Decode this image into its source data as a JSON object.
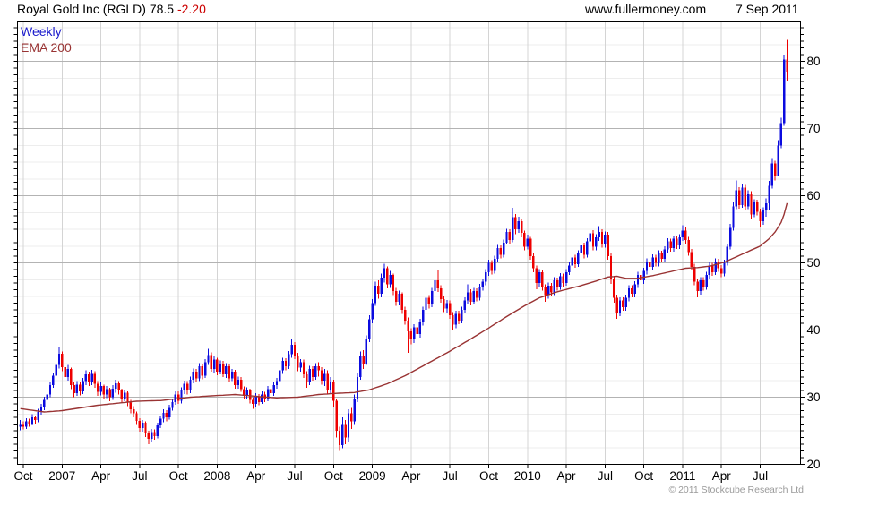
{
  "header": {
    "title": "Royal Gold Inc (RGLD) 78.5",
    "change": "-2.20",
    "site": "www.fullermoney.com",
    "date": "7 Sep 2011"
  },
  "legend": {
    "timeframe": "Weekly",
    "indicator": "EMA 200"
  },
  "footer": {
    "copyright": "© 2011 Stockcube Research Ltd"
  },
  "colors": {
    "up_candle": "#0b0bdf",
    "down_candle": "#ee0000",
    "ema_line": "#993333",
    "weekly_label": "#1a1acc",
    "ema_label": "#993333",
    "change_text": "#cc0000",
    "copyright_text": "#9a9a9a",
    "grid_minor": "#ededed",
    "grid_major": "#b3b3b3",
    "grid_vertical": "#d4d4d4",
    "axis": "#000000"
  },
  "chart_data": {
    "type": "candlestick",
    "timeframe": "Weekly",
    "indicator": "EMA 200",
    "title": "Royal Gold Inc (RGLD)",
    "last_price": 78.5,
    "change": -2.2,
    "y_axis": {
      "min": 20,
      "max": 85.9,
      "major_tick_labels": [
        20,
        30,
        40,
        50,
        60,
        70,
        80
      ],
      "minor_tick_step": 1,
      "grid_minor_step": 2.5,
      "grid_major_step": 10,
      "side": "right"
    },
    "x_axis": {
      "tick_labels": [
        "Oct",
        "2007",
        "Apr",
        "Jul",
        "Oct",
        "2008",
        "Apr",
        "Jul",
        "Oct",
        "2009",
        "Apr",
        "Jul",
        "Oct",
        "2010",
        "Apr",
        "Jul",
        "Oct",
        "2011",
        "Apr",
        "Jul"
      ],
      "tick_week_indexes": [
        1,
        14,
        27,
        40,
        53,
        66,
        79,
        92,
        105,
        118,
        131,
        144,
        157,
        170,
        183,
        196,
        209,
        222,
        235,
        248
      ],
      "start": "Oct 2006",
      "end": "7 Sep 2011"
    },
    "first_open": 25.6,
    "candles_hlc": [
      [
        26.6,
        25.1,
        26.0
      ],
      [
        26.4,
        25.2,
        25.6
      ],
      [
        26.9,
        25.3,
        26.4
      ],
      [
        26.8,
        25.6,
        26.1
      ],
      [
        27.5,
        25.8,
        27.0
      ],
      [
        27.3,
        26.1,
        26.6
      ],
      [
        28.3,
        26.3,
        27.8
      ],
      [
        29.0,
        27.4,
        28.5
      ],
      [
        30.1,
        28.1,
        29.6
      ],
      [
        30.9,
        29.2,
        30.4
      ],
      [
        32.3,
        30.0,
        31.8
      ],
      [
        33.7,
        31.4,
        33.2
      ],
      [
        35.3,
        32.6,
        34.8
      ],
      [
        37.4,
        34.3,
        36.5
      ],
      [
        36.8,
        33.9,
        34.5
      ],
      [
        34.9,
        32.3,
        33.0
      ],
      [
        34.8,
        32.5,
        34.2
      ],
      [
        34.4,
        31.2,
        31.8
      ],
      [
        32.2,
        30.0,
        30.6
      ],
      [
        32.4,
        30.2,
        31.9
      ],
      [
        32.2,
        30.3,
        30.9
      ],
      [
        32.9,
        30.5,
        32.4
      ],
      [
        34.0,
        31.8,
        33.4
      ],
      [
        33.8,
        31.7,
        32.2
      ],
      [
        34.1,
        31.8,
        33.5
      ],
      [
        33.9,
        31.4,
        32.0
      ],
      [
        32.4,
        30.2,
        30.8
      ],
      [
        32.2,
        30.3,
        31.7
      ],
      [
        31.9,
        29.8,
        30.4
      ],
      [
        31.7,
        29.9,
        31.2
      ],
      [
        31.4,
        29.4,
        30.0
      ],
      [
        31.8,
        29.6,
        31.3
      ],
      [
        32.6,
        30.7,
        32.1
      ],
      [
        32.4,
        30.4,
        31.0
      ],
      [
        31.3,
        29.3,
        29.8
      ],
      [
        31.1,
        29.4,
        30.7
      ],
      [
        30.9,
        28.7,
        29.2
      ],
      [
        29.6,
        27.6,
        28.2
      ],
      [
        28.7,
        27.0,
        27.6
      ],
      [
        27.9,
        26.0,
        26.5
      ],
      [
        26.9,
        24.9,
        25.4
      ],
      [
        26.6,
        24.9,
        26.2
      ],
      [
        26.4,
        24.1,
        24.6
      ],
      [
        25.0,
        23.0,
        23.8
      ],
      [
        25.3,
        23.3,
        24.8
      ],
      [
        25.2,
        23.7,
        24.2
      ],
      [
        26.2,
        23.9,
        25.8
      ],
      [
        27.3,
        25.4,
        26.8
      ],
      [
        28.2,
        26.3,
        27.7
      ],
      [
        28.1,
        26.4,
        27.0
      ],
      [
        28.9,
        26.7,
        28.4
      ],
      [
        29.8,
        28.0,
        29.3
      ],
      [
        30.9,
        28.9,
        30.4
      ],
      [
        30.9,
        29.0,
        29.5
      ],
      [
        31.5,
        29.1,
        31.0
      ],
      [
        32.5,
        30.5,
        32.0
      ],
      [
        32.4,
        30.4,
        31.0
      ],
      [
        33.1,
        30.6,
        32.6
      ],
      [
        34.3,
        32.1,
        33.8
      ],
      [
        34.2,
        32.2,
        32.8
      ],
      [
        35.1,
        32.4,
        34.6
      ],
      [
        35.0,
        32.7,
        33.2
      ],
      [
        35.7,
        32.9,
        35.2
      ],
      [
        37.2,
        34.8,
        36.3
      ],
      [
        36.7,
        33.8,
        34.2
      ],
      [
        36.1,
        33.7,
        35.6
      ],
      [
        35.9,
        33.3,
        33.8
      ],
      [
        35.5,
        33.4,
        35.0
      ],
      [
        35.4,
        33.0,
        33.4
      ],
      [
        35.1,
        32.9,
        34.6
      ],
      [
        34.9,
        32.3,
        32.8
      ],
      [
        34.2,
        32.4,
        33.8
      ],
      [
        34.1,
        31.3,
        31.8
      ],
      [
        33.1,
        31.3,
        32.6
      ],
      [
        33.0,
        30.8,
        31.2
      ],
      [
        31.6,
        29.7,
        30.2
      ],
      [
        31.5,
        29.7,
        31.0
      ],
      [
        31.3,
        29.1,
        29.6
      ],
      [
        30.0,
        28.3,
        29.0
      ],
      [
        30.6,
        28.6,
        30.1
      ],
      [
        30.5,
        28.8,
        29.3
      ],
      [
        30.9,
        29.0,
        30.4
      ],
      [
        30.8,
        29.3,
        29.8
      ],
      [
        31.7,
        29.4,
        31.2
      ],
      [
        31.6,
        30.1,
        30.6
      ],
      [
        32.3,
        30.2,
        31.8
      ],
      [
        32.9,
        31.3,
        32.4
      ],
      [
        34.5,
        32.0,
        34.0
      ],
      [
        35.9,
        33.5,
        35.4
      ],
      [
        35.8,
        34.0,
        34.6
      ],
      [
        36.9,
        34.2,
        36.4
      ],
      [
        38.6,
        35.9,
        37.8
      ],
      [
        38.2,
        35.7,
        36.2
      ],
      [
        36.6,
        33.9,
        34.4
      ],
      [
        35.7,
        33.8,
        35.2
      ],
      [
        35.6,
        32.9,
        33.4
      ],
      [
        33.9,
        31.4,
        32.2
      ],
      [
        34.7,
        31.8,
        34.2
      ],
      [
        34.6,
        32.5,
        33.0
      ],
      [
        35.1,
        32.6,
        34.6
      ],
      [
        35.2,
        33.1,
        34.0
      ],
      [
        34.5,
        31.9,
        32.5
      ],
      [
        34.2,
        31.7,
        33.5
      ],
      [
        34.0,
        30.4,
        31.0
      ],
      [
        33.0,
        30.5,
        32.3
      ],
      [
        32.6,
        28.6,
        29.5
      ],
      [
        29.8,
        24.0,
        25.0
      ],
      [
        25.6,
        22.0,
        22.9
      ],
      [
        27.0,
        22.4,
        26.0
      ],
      [
        26.6,
        23.0,
        24.0
      ],
      [
        28.2,
        23.4,
        27.6
      ],
      [
        28.4,
        25.3,
        26.4
      ],
      [
        30.4,
        26.0,
        29.8
      ],
      [
        33.6,
        29.3,
        33.0
      ],
      [
        36.8,
        32.6,
        36.2
      ],
      [
        37.0,
        34.2,
        35.0
      ],
      [
        39.2,
        34.8,
        38.6
      ],
      [
        42.2,
        38.2,
        41.6
      ],
      [
        44.6,
        41.0,
        44.0
      ],
      [
        47.2,
        43.6,
        46.6
      ],
      [
        47.4,
        44.7,
        45.4
      ],
      [
        48.4,
        44.9,
        47.8
      ],
      [
        49.9,
        47.1,
        49.2
      ],
      [
        49.5,
        46.2,
        46.8
      ],
      [
        48.8,
        46.3,
        48.2
      ],
      [
        48.4,
        45.2,
        45.8
      ],
      [
        46.3,
        43.6,
        44.2
      ],
      [
        45.9,
        43.7,
        45.4
      ],
      [
        45.6,
        42.4,
        43.0
      ],
      [
        43.5,
        40.8,
        41.4
      ],
      [
        41.9,
        36.6,
        39.8
      ],
      [
        40.3,
        37.9,
        38.6
      ],
      [
        40.9,
        38.1,
        40.4
      ],
      [
        40.8,
        38.8,
        39.4
      ],
      [
        41.7,
        38.9,
        41.2
      ],
      [
        43.5,
        40.7,
        43.0
      ],
      [
        45.3,
        42.5,
        44.8
      ],
      [
        45.2,
        43.2,
        43.8
      ],
      [
        46.3,
        43.4,
        45.8
      ],
      [
        48.3,
        45.3,
        47.4
      ],
      [
        48.9,
        45.7,
        46.2
      ],
      [
        46.7,
        44.1,
        44.6
      ],
      [
        45.1,
        42.7,
        43.2
      ],
      [
        44.5,
        42.6,
        44.0
      ],
      [
        44.4,
        41.7,
        42.2
      ],
      [
        42.7,
        40.1,
        40.8
      ],
      [
        42.9,
        40.3,
        42.4
      ],
      [
        42.9,
        40.9,
        41.4
      ],
      [
        43.5,
        41.0,
        43.0
      ],
      [
        44.9,
        42.5,
        44.4
      ],
      [
        46.8,
        43.9,
        45.6
      ],
      [
        46.1,
        43.7,
        44.2
      ],
      [
        46.3,
        43.8,
        45.8
      ],
      [
        46.2,
        44.3,
        44.8
      ],
      [
        46.9,
        44.4,
        46.4
      ],
      [
        47.7,
        45.9,
        47.2
      ],
      [
        49.1,
        46.7,
        48.6
      ],
      [
        50.5,
        48.1,
        50.0
      ],
      [
        50.4,
        48.3,
        48.8
      ],
      [
        51.1,
        48.4,
        50.6
      ],
      [
        52.7,
        50.1,
        52.2
      ],
      [
        52.6,
        50.7,
        51.2
      ],
      [
        53.5,
        50.8,
        53.0
      ],
      [
        55.1,
        52.9,
        54.6
      ],
      [
        55.0,
        52.9,
        53.4
      ],
      [
        58.2,
        53.1,
        56.8
      ],
      [
        57.3,
        54.3,
        55.0
      ],
      [
        56.9,
        54.5,
        56.2
      ],
      [
        56.6,
        53.8,
        54.5
      ],
      [
        54.8,
        51.9,
        52.4
      ],
      [
        54.2,
        52.0,
        53.6
      ],
      [
        53.9,
        50.5,
        51.0
      ],
      [
        51.5,
        48.6,
        49.2
      ],
      [
        49.6,
        46.1,
        47.0
      ],
      [
        49.1,
        46.5,
        48.6
      ],
      [
        48.9,
        45.9,
        46.4
      ],
      [
        46.8,
        44.2,
        45.2
      ],
      [
        47.1,
        44.7,
        46.6
      ],
      [
        47.0,
        45.1,
        45.6
      ],
      [
        47.9,
        45.2,
        47.4
      ],
      [
        47.8,
        45.9,
        46.4
      ],
      [
        48.5,
        46.0,
        48.0
      ],
      [
        48.4,
        46.5,
        47.0
      ],
      [
        49.1,
        46.6,
        48.6
      ],
      [
        50.1,
        48.2,
        49.6
      ],
      [
        51.3,
        49.0,
        50.8
      ],
      [
        51.2,
        49.3,
        49.8
      ],
      [
        51.9,
        49.4,
        51.4
      ],
      [
        53.1,
        50.9,
        52.6
      ],
      [
        53.0,
        50.7,
        51.2
      ],
      [
        53.7,
        50.8,
        53.2
      ],
      [
        55.1,
        52.7,
        54.4
      ],
      [
        54.9,
        51.9,
        52.4
      ],
      [
        54.3,
        51.9,
        53.8
      ],
      [
        55.5,
        53.3,
        54.6
      ],
      [
        55.0,
        52.3,
        52.8
      ],
      [
        54.7,
        52.3,
        54.2
      ],
      [
        54.6,
        50.5,
        51.0
      ],
      [
        51.5,
        46.9,
        47.6
      ],
      [
        48.1,
        44.1,
        44.8
      ],
      [
        45.3,
        41.7,
        42.6
      ],
      [
        44.9,
        42.1,
        44.4
      ],
      [
        44.9,
        42.9,
        43.4
      ],
      [
        45.3,
        42.9,
        44.8
      ],
      [
        46.7,
        44.3,
        46.2
      ],
      [
        46.7,
        44.9,
        45.4
      ],
      [
        47.3,
        44.9,
        46.8
      ],
      [
        48.7,
        46.3,
        48.2
      ],
      [
        48.6,
        46.9,
        47.4
      ],
      [
        49.3,
        46.9,
        48.8
      ],
      [
        50.7,
        48.3,
        50.2
      ],
      [
        50.6,
        48.9,
        49.4
      ],
      [
        51.3,
        48.9,
        50.8
      ],
      [
        51.2,
        49.5,
        50.0
      ],
      [
        51.9,
        49.5,
        51.4
      ],
      [
        51.8,
        50.1,
        50.6
      ],
      [
        52.5,
        50.1,
        52.0
      ],
      [
        53.7,
        51.5,
        53.2
      ],
      [
        53.6,
        51.7,
        52.2
      ],
      [
        54.1,
        51.7,
        53.6
      ],
      [
        54.0,
        52.1,
        52.6
      ],
      [
        54.3,
        52.1,
        53.8
      ],
      [
        55.6,
        53.3,
        54.8
      ],
      [
        55.3,
        52.9,
        53.4
      ],
      [
        53.9,
        51.1,
        51.6
      ],
      [
        52.1,
        48.9,
        49.4
      ],
      [
        49.9,
        46.7,
        47.2
      ],
      [
        47.7,
        44.9,
        45.8
      ],
      [
        47.9,
        45.3,
        47.4
      ],
      [
        47.9,
        45.9,
        46.4
      ],
      [
        48.7,
        46.0,
        48.2
      ],
      [
        50.1,
        47.7,
        49.6
      ],
      [
        50.0,
        48.1,
        48.6
      ],
      [
        50.7,
        48.2,
        50.2
      ],
      [
        50.6,
        48.7,
        49.2
      ],
      [
        49.7,
        47.9,
        48.4
      ],
      [
        50.5,
        48.0,
        50.0
      ],
      [
        52.9,
        49.6,
        52.4
      ],
      [
        55.8,
        52.0,
        55.2
      ],
      [
        59.0,
        54.8,
        58.4
      ],
      [
        62.3,
        58.0,
        60.8
      ],
      [
        61.3,
        58.1,
        58.6
      ],
      [
        61.8,
        58.2,
        61.2
      ],
      [
        61.6,
        57.9,
        58.4
      ],
      [
        60.8,
        58.0,
        60.2
      ],
      [
        60.7,
        56.6,
        57.2
      ],
      [
        59.5,
        56.8,
        59.0
      ],
      [
        59.4,
        57.1,
        57.6
      ],
      [
        58.1,
        55.4,
        56.2
      ],
      [
        58.3,
        55.7,
        57.8
      ],
      [
        59.6,
        56.9,
        58.9
      ],
      [
        62.2,
        57.9,
        61.5
      ],
      [
        65.6,
        61.1,
        64.8
      ],
      [
        65.2,
        62.3,
        63.0
      ],
      [
        68.3,
        62.9,
        67.5
      ],
      [
        71.6,
        67.1,
        70.8
      ],
      [
        81.0,
        70.4,
        80.3
      ],
      [
        83.2,
        77.1,
        78.5
      ]
    ],
    "ema200_keypoints": [
      [
        0,
        28.3
      ],
      [
        8,
        27.8
      ],
      [
        14,
        28.0
      ],
      [
        26,
        28.8
      ],
      [
        39,
        29.4
      ],
      [
        47,
        29.5
      ],
      [
        57,
        30.0
      ],
      [
        64,
        30.2
      ],
      [
        72,
        30.4
      ],
      [
        80,
        30.1
      ],
      [
        86,
        29.9
      ],
      [
        93,
        30.0
      ],
      [
        100,
        30.4
      ],
      [
        107,
        30.6
      ],
      [
        112,
        30.7
      ],
      [
        117,
        31.1
      ],
      [
        123,
        32.0
      ],
      [
        129,
        33.2
      ],
      [
        136,
        34.9
      ],
      [
        143,
        36.6
      ],
      [
        150,
        38.4
      ],
      [
        157,
        40.3
      ],
      [
        163,
        42.0
      ],
      [
        169,
        43.6
      ],
      [
        174,
        44.8
      ],
      [
        180,
        45.7
      ],
      [
        187,
        46.5
      ],
      [
        193,
        47.3
      ],
      [
        197,
        47.9
      ],
      [
        200,
        48.0
      ],
      [
        203,
        47.7
      ],
      [
        207,
        47.7
      ],
      [
        212,
        48.1
      ],
      [
        218,
        48.7
      ],
      [
        223,
        49.2
      ],
      [
        227,
        49.3
      ],
      [
        231,
        49.5
      ],
      [
        236,
        50.1
      ],
      [
        240,
        50.9
      ],
      [
        244,
        51.7
      ],
      [
        248,
        52.5
      ],
      [
        251,
        53.6
      ],
      [
        253,
        54.6
      ],
      [
        255,
        56.0
      ],
      [
        256,
        57.2
      ],
      [
        257,
        58.9
      ]
    ]
  }
}
